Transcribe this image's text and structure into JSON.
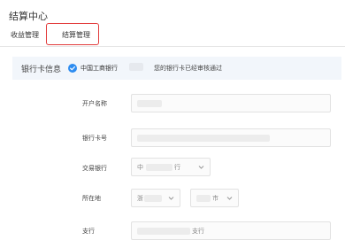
{
  "page": {
    "title": "结算中心"
  },
  "tabs": [
    {
      "label": "收益管理",
      "active": false
    },
    {
      "label": "结算管理",
      "active": true
    }
  ],
  "colors": {
    "active_tab_outline": "#e23a3a",
    "check_icon": "#2d8cf0",
    "info_bar_bg": "#f2f6fb"
  },
  "bank_info": {
    "label": "银行卡信息",
    "icon": "check-circle-icon",
    "bank_name": "中国工商银行",
    "status_text": "您的银行卡已经审核通过"
  },
  "form": {
    "account_name_label": "开户名称",
    "card_number_label": "银行卡号",
    "transaction_bank_label": "交易银行",
    "transaction_bank_value": "中",
    "transaction_bank_suffix": "行",
    "location_label": "所在地",
    "province_value": "浙",
    "city_value": "市",
    "branch_label": "支行",
    "branch_value": "支行"
  }
}
